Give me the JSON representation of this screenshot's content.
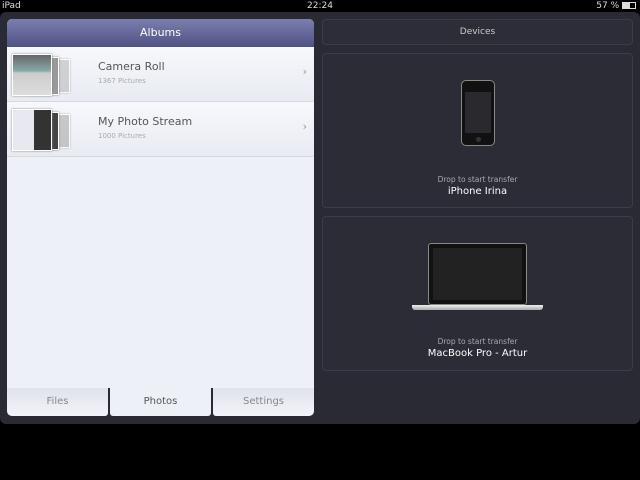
{
  "status": {
    "device": "iPad",
    "time": "22:24",
    "battery": "57 %"
  },
  "albums": {
    "title": "Albums",
    "items": [
      {
        "name": "Camera Roll",
        "count": "1367 Pictures"
      },
      {
        "name": "My Photo Stream",
        "count": "1000 Pictures"
      }
    ]
  },
  "tabs": [
    {
      "label": "Files"
    },
    {
      "label": "Photos"
    },
    {
      "label": "Settings"
    }
  ],
  "devices": {
    "title": "Devices",
    "items": [
      {
        "hint": "Drop to start transfer",
        "name": "iPhone Irina"
      },
      {
        "hint": "Drop to start transfer",
        "name": "MacBook Pro - Artur"
      }
    ]
  }
}
